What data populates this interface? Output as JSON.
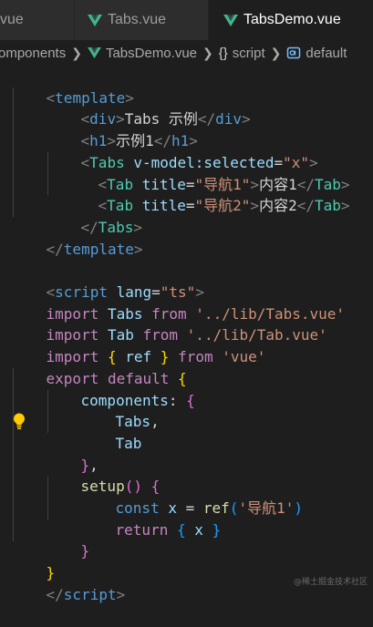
{
  "tabs": [
    {
      "label": "vue",
      "active": false
    },
    {
      "label": "Tabs.vue",
      "active": false
    },
    {
      "label": "TabsDemo.vue",
      "active": true
    }
  ],
  "breadcrumb": {
    "folder": "omponents",
    "file": "TabsDemo.vue",
    "section_icon": "{}",
    "section": "script",
    "symbol": "default"
  },
  "code": {
    "l1": {
      "a": "<",
      "b": "template",
      "c": ">"
    },
    "l2": {
      "a": "<",
      "b": "div",
      "c": ">",
      "d": "Tabs 示例",
      "e": "</",
      "f": "div",
      "g": ">"
    },
    "l3": {
      "a": "<",
      "b": "h1",
      "c": ">",
      "d": "示例1",
      "e": "</",
      "f": "h1",
      "g": ">"
    },
    "l4": {
      "a": "<",
      "b": "Tabs",
      "c": " v-model:selected",
      "d": "=",
      "e": "\"x\"",
      "f": ">"
    },
    "l5": {
      "a": "<",
      "b": "Tab",
      "c": " title",
      "d": "=",
      "e": "\"导航1\"",
      "f": ">",
      "g": "内容1",
      "h": "</",
      "i": "Tab",
      "j": ">"
    },
    "l6": {
      "a": "<",
      "b": "Tab",
      "c": " title",
      "d": "=",
      "e": "\"导航2\"",
      "f": ">",
      "g": "内容2",
      "h": "</",
      "i": "Tab",
      "j": ">"
    },
    "l7": {
      "a": "</",
      "b": "Tabs",
      "c": ">"
    },
    "l8": {
      "a": "</",
      "b": "template",
      "c": ">"
    },
    "l10": {
      "a": "<",
      "b": "script",
      "c": " lang",
      "d": "=",
      "e": "\"ts\"",
      "f": ">"
    },
    "l11": {
      "a": "import",
      "b": " Tabs ",
      "c": "from",
      "d": " ",
      "e": "'../lib/Tabs.vue'"
    },
    "l12": {
      "a": "import",
      "b": " Tab ",
      "c": "from",
      "d": " ",
      "e": "'../lib/Tab.vue'"
    },
    "l13": {
      "a": "import",
      "b": " ",
      "c": "{",
      "d": " ref ",
      "e": "}",
      "f": " ",
      "g": "from",
      "h": " ",
      "i": "'vue'"
    },
    "l14": {
      "a": "export",
      "b": " ",
      "c": "default",
      "d": " ",
      "e": "{"
    },
    "l15": {
      "a": "components",
      "b": ": ",
      "c": "{"
    },
    "l16": {
      "a": "Tabs",
      "b": ","
    },
    "l17": {
      "a": "Tab"
    },
    "l18": {
      "a": "}",
      "b": ","
    },
    "l19": {
      "a": "setup",
      "b": "()",
      "c": " ",
      "d": "{"
    },
    "l20": {
      "a": "const",
      "b": " x ",
      "c": "=",
      "d": " ",
      "e": "ref",
      "f": "(",
      "g": "'导航1'",
      "h": ")"
    },
    "l21": {
      "a": "return",
      "b": " ",
      "c": "{",
      "d": " x ",
      "e": "}"
    },
    "l22": {
      "a": "}"
    },
    "l23": {
      "a": "}"
    },
    "l24": {
      "a": "</",
      "b": "script",
      "c": ">"
    }
  },
  "watermark": "@稀土掘金技术社区",
  "colors": {
    "editor_bg": "#1e1e1e",
    "tab_bar_bg": "#252526",
    "vue_green": "#41b883",
    "lightbulb": "#ffcc00"
  },
  "icons": {
    "vue_file": "vue-logo-icon",
    "breadcrumb_separator": "chevron-right-icon",
    "symbol": "symbol-namespace-icon",
    "code_action": "lightbulb-icon"
  }
}
